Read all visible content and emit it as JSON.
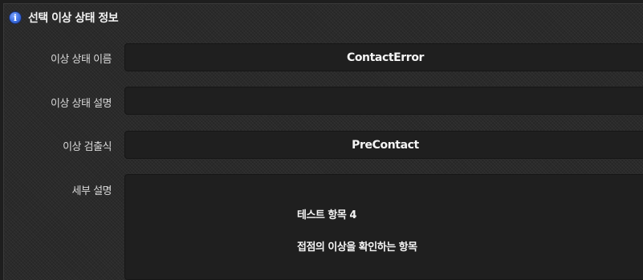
{
  "header": {
    "title": "선택 이상 상태 정보",
    "icon": "info-icon"
  },
  "fields": {
    "name": {
      "label": "이상 상태 이름",
      "value": "ContactError"
    },
    "description": {
      "label": "이상 상태 설명",
      "value": ""
    },
    "expression": {
      "label": "이상 검출식",
      "value": "PreContact"
    },
    "detail": {
      "label": "세부 설명",
      "lines": [
        "테스트 항목 4",
        "접점의 이상을 확인하는 항목"
      ]
    }
  },
  "colors": {
    "background": "#2a2a2a",
    "field_background": "#1f1f1f",
    "icon_accent": "#3d6fe0"
  }
}
